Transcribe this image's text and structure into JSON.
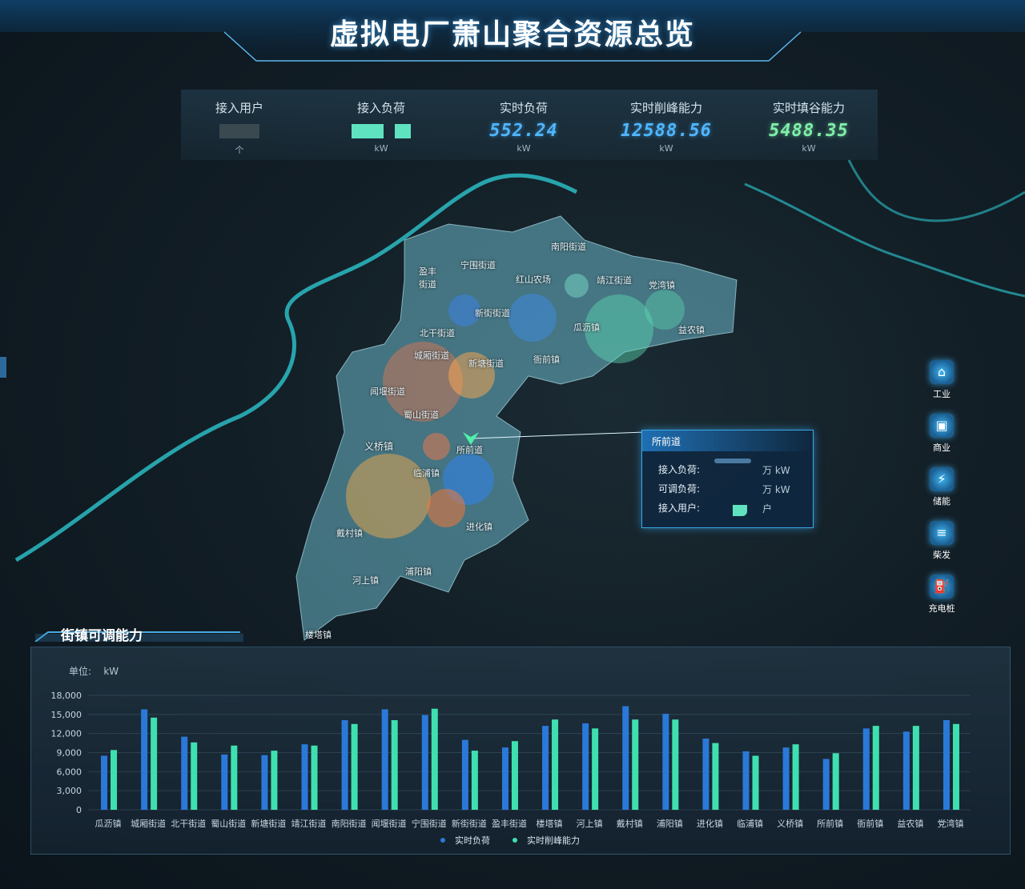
{
  "header": {
    "title": "虚拟电厂萧山聚合资源总览"
  },
  "stats": [
    {
      "label": "接入用户",
      "value": "",
      "unit": "个"
    },
    {
      "label": "接入负荷",
      "value": "",
      "unit": "kW"
    },
    {
      "label": "实时负荷",
      "value": "552.24",
      "unit": "kW",
      "color": "#4fb6ff"
    },
    {
      "label": "实时削峰能力",
      "value": "12588.56",
      "unit": "kW",
      "color": "#4fb6ff"
    },
    {
      "label": "实时填谷能力",
      "value": "5488.35",
      "unit": "kW",
      "color": "#7ff0a8"
    }
  ],
  "map": {
    "districts": [
      "南阳街道",
      "宁围街道",
      "盈丰街道",
      "红山农场",
      "靖江街道",
      "党湾镇",
      "新街街道",
      "瓜沥镇",
      "益农镇",
      "北干街道",
      "城厢街道",
      "新塘街道",
      "衙前镇",
      "闻堰街道",
      "蜀山街道",
      "义桥镇",
      "所前道",
      "临浦镇",
      "戴村镇",
      "进化镇",
      "河上镇",
      "浦阳镇",
      "楼塔镇"
    ]
  },
  "popup": {
    "title": "所前道",
    "rows": [
      {
        "label": "接入负荷:",
        "unit": "万 kW"
      },
      {
        "label": "可调负荷:",
        "unit": "万 kW"
      },
      {
        "label": "接入用户:",
        "unit": "户"
      }
    ]
  },
  "legend": [
    {
      "label": "工业",
      "icon": "factory-icon"
    },
    {
      "label": "商业",
      "icon": "shop-icon"
    },
    {
      "label": "储能",
      "icon": "battery-icon"
    },
    {
      "label": "柴发",
      "icon": "generator-icon"
    },
    {
      "label": "充电桩",
      "icon": "charging-pile-icon"
    }
  ],
  "chart_panel": {
    "title": "街镇可调能力",
    "unit_prefix": "单位:",
    "unit": "kW"
  },
  "chart_data": {
    "type": "bar",
    "categories": [
      "瓜沥镇",
      "城厢街道",
      "北干街道",
      "蜀山街道",
      "新塘街道",
      "靖江街道",
      "南阳街道",
      "闻堰街道",
      "宁围街道",
      "新街街道",
      "盈丰街道",
      "楼塔镇",
      "河上镇",
      "戴村镇",
      "浦阳镇",
      "进化镇",
      "临浦镇",
      "义桥镇",
      "所前镇",
      "衙前镇",
      "益农镇",
      "党湾镇"
    ],
    "series": [
      {
        "name": "实时负荷",
        "color": "#2a79d8",
        "values": [
          8500,
          15800,
          11500,
          8700,
          8600,
          10300,
          14100,
          15800,
          14900,
          11000,
          9800,
          13200,
          13600,
          16300,
          15100,
          11200,
          9200,
          9800,
          8000,
          12800,
          12300,
          14100
        ]
      },
      {
        "name": "实时削峰能力",
        "color": "#3fe0b0",
        "values": [
          9400,
          14500,
          10600,
          10100,
          9300,
          10100,
          13500,
          14100,
          15900,
          9300,
          10800,
          14200,
          12800,
          14200,
          14200,
          10500,
          8500,
          10300,
          8900,
          13200,
          13200,
          13500
        ]
      }
    ],
    "yticks": [
      "18,000",
      "15,000",
      "12,000",
      "9,000",
      "6,000",
      "3,000",
      "0"
    ],
    "ylim": [
      0,
      18000
    ],
    "grid": true,
    "legend_position": "bottom-center"
  },
  "colors": {
    "accent": "#3aa7e8",
    "green": "#3fe0b0",
    "blue": "#2a79d8"
  }
}
